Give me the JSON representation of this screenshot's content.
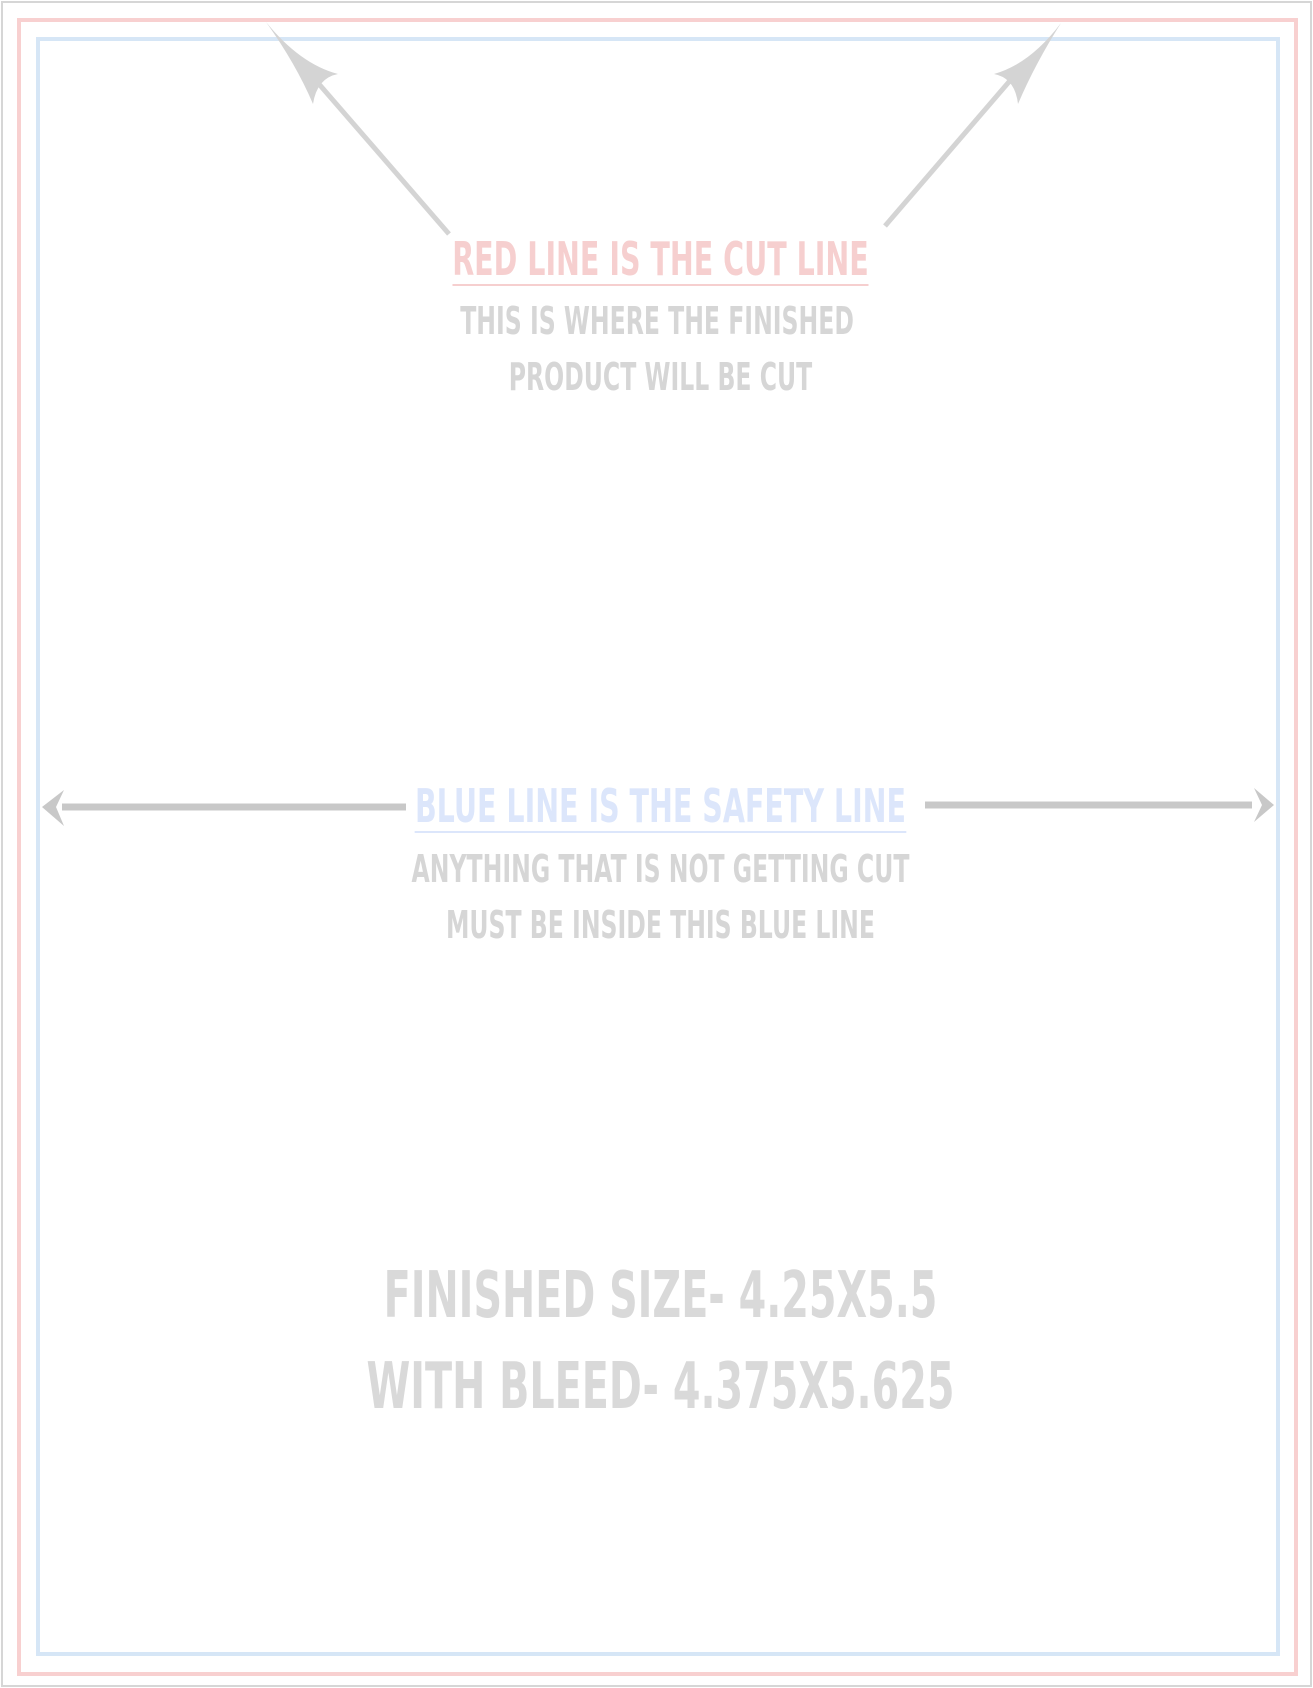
{
  "template": {
    "cut_line": {
      "title": "RED LINE IS THE CUT LINE",
      "line1": "THIS IS WHERE THE FINISHED",
      "line2": "PRODUCT WILL BE CUT",
      "color": "#f6cfcf"
    },
    "safety_line": {
      "title": "BLUE LINE IS THE SAFETY LINE",
      "line1": "ANYTHING THAT IS NOT GETTING CUT",
      "line2": "MUST BE INSIDE THIS BLUE LINE",
      "color": "#dce6fb"
    },
    "sizes": {
      "finished": "FINISHED SIZE- 4.25X5.5",
      "bleed": "WITH BLEED- 4.375X5.625"
    },
    "text_color": "#d6d6d6",
    "arrow_color": "#d4d4d4"
  }
}
